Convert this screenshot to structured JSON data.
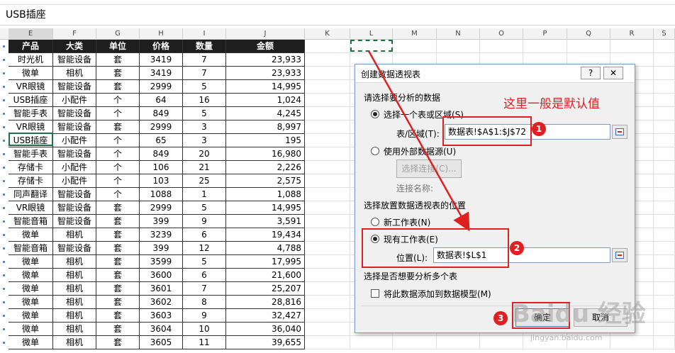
{
  "formula_bar": {
    "content": "USB插座"
  },
  "columns": [
    "E",
    "F",
    "G",
    "H",
    "I",
    "J",
    "K",
    "L",
    "M",
    "N",
    "O",
    "P",
    "Q",
    "R",
    "S"
  ],
  "table": {
    "headers": [
      "产品",
      "大类",
      "单位",
      "价格",
      "数量",
      "金额"
    ],
    "rows": [
      [
        "时光机",
        "智能设备",
        "套",
        "3419",
        "7",
        "23,933"
      ],
      [
        "微单",
        "相机",
        "套",
        "3419",
        "7",
        "23,933"
      ],
      [
        "VR眼镜",
        "智能设备",
        "套",
        "2999",
        "5",
        "14,995"
      ],
      [
        "USB插座",
        "小配件",
        "个",
        "64",
        "16",
        "1,024"
      ],
      [
        "智能手表",
        "智能设备",
        "个",
        "849",
        "5",
        "4,245"
      ],
      [
        "VR眼镜",
        "智能设备",
        "套",
        "2999",
        "3",
        "8,997"
      ],
      [
        "USB插座",
        "小配件",
        "个",
        "65",
        "3",
        "195"
      ],
      [
        "智能手表",
        "智能设备",
        "个",
        "849",
        "20",
        "16,980"
      ],
      [
        "存储卡",
        "小配件",
        "个",
        "106",
        "21",
        "2,226"
      ],
      [
        "存储卡",
        "小配件",
        "个",
        "103",
        "25",
        "2,575"
      ],
      [
        "同声翻译",
        "智能设备",
        "个",
        "1088",
        "1",
        "1,088"
      ],
      [
        "VR眼镜",
        "智能设备",
        "套",
        "2999",
        "5",
        "14,995"
      ],
      [
        "智能音箱",
        "智能设备",
        "套",
        "399",
        "9",
        "3,591"
      ],
      [
        "微单",
        "相机",
        "套",
        "3239",
        "6",
        "19,434"
      ],
      [
        "智能音箱",
        "智能设备",
        "套",
        "399",
        "12",
        "4,788"
      ],
      [
        "微单",
        "相机",
        "套",
        "3599",
        "5",
        "17,995"
      ],
      [
        "微单",
        "相机",
        "套",
        "3600",
        "6",
        "21,600"
      ],
      [
        "微单",
        "相机",
        "套",
        "3601",
        "7",
        "25,207"
      ],
      [
        "微单",
        "相机",
        "套",
        "3602",
        "8",
        "28,816"
      ],
      [
        "微单",
        "相机",
        "套",
        "3603",
        "9",
        "32,427"
      ],
      [
        "微单",
        "相机",
        "套",
        "3604",
        "10",
        "36,040"
      ],
      [
        "微单",
        "相机",
        "套",
        "3605",
        "11",
        "39,655"
      ]
    ]
  },
  "dialog": {
    "title": "创建数据透视表",
    "help": "?",
    "close": "✕",
    "section1": "请选择要分析的数据",
    "opt_select_range": "选择一个表或区域(S)",
    "range_label": "表/区域(T):",
    "range_value": "数据表!$A$1:$J$72",
    "opt_external": "使用外部数据源(U)",
    "choose_conn": "选择连接(C)...",
    "conn_name": "连接名称:",
    "section2": "选择放置数据透视表的位置",
    "opt_new_sheet": "新工作表(N)",
    "opt_existing": "现有工作表(E)",
    "location_label": "位置(L):",
    "location_value": "数据表!$L$1",
    "section3": "选择是否想要分析多个表",
    "add_model": "将此数据添加到数据模型(M)",
    "ok": "确定",
    "cancel": "取消"
  },
  "annotation": {
    "note": "这里一般是默认值",
    "badge1": "1",
    "badge2": "2",
    "badge3": "3",
    "color": "#e02020"
  },
  "watermark": {
    "text": "Baidu 经验",
    "url": "jingyan.baidu.com"
  }
}
